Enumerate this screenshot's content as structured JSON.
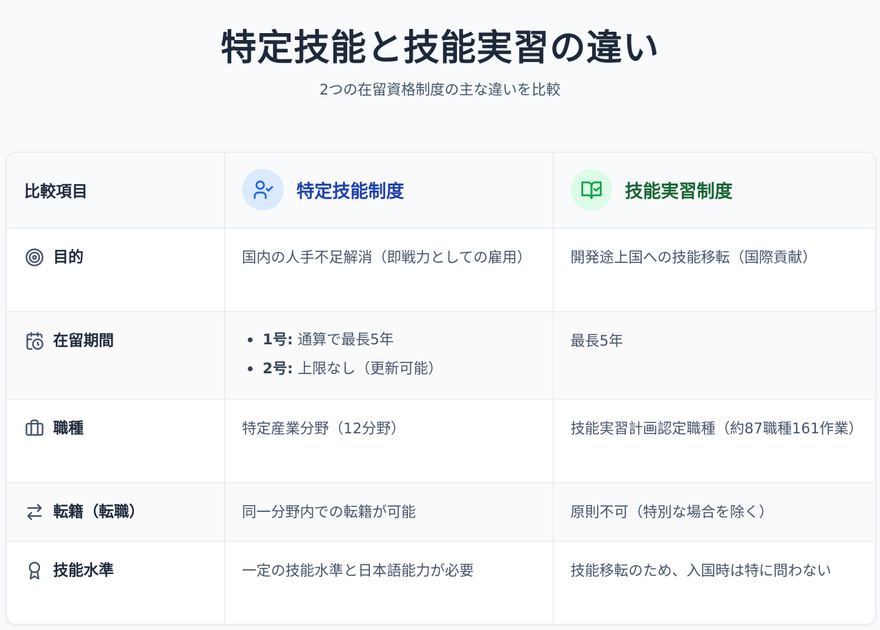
{
  "header": {
    "title": "特定技能と技能実習の違い",
    "subtitle": "2つの在留資格制度の主な違いを比較"
  },
  "table": {
    "head": {
      "item_label": "比較項目",
      "col1": {
        "title": "特定技能制度",
        "icon": "user-check-icon",
        "color": "#1e40af"
      },
      "col2": {
        "title": "技能実習制度",
        "icon": "book-check-icon",
        "color": "#166534"
      }
    },
    "rows": [
      {
        "label": "目的",
        "icon": "target-icon",
        "col1": "国内の人手不足解消（即戦力としての雇用）",
        "col2": "開発途上国への技能移転（国際貢献）"
      },
      {
        "label": "在留期間",
        "icon": "calendar-clock-icon",
        "col1_items": [
          {
            "key": "1号:",
            "text": " 通算で最長5年"
          },
          {
            "key": "2号:",
            "text": " 上限なし（更新可能）"
          }
        ],
        "col2": "最長5年"
      },
      {
        "label": "職種",
        "icon": "briefcase-icon",
        "col1": "特定産業分野（12分野）",
        "col2": "技能実習計画認定職種（約87職種161作業）"
      },
      {
        "label": "転籍（転職）",
        "icon": "arrows-swap-icon",
        "col1": "同一分野内での転籍が可能",
        "col2": "原則不可（特別な場合を除く）"
      },
      {
        "label": "技能水準",
        "icon": "award-icon",
        "col1": "一定の技能水準と日本語能力が必要",
        "col2": "技能移転のため、入国時は特に問わない"
      }
    ]
  }
}
